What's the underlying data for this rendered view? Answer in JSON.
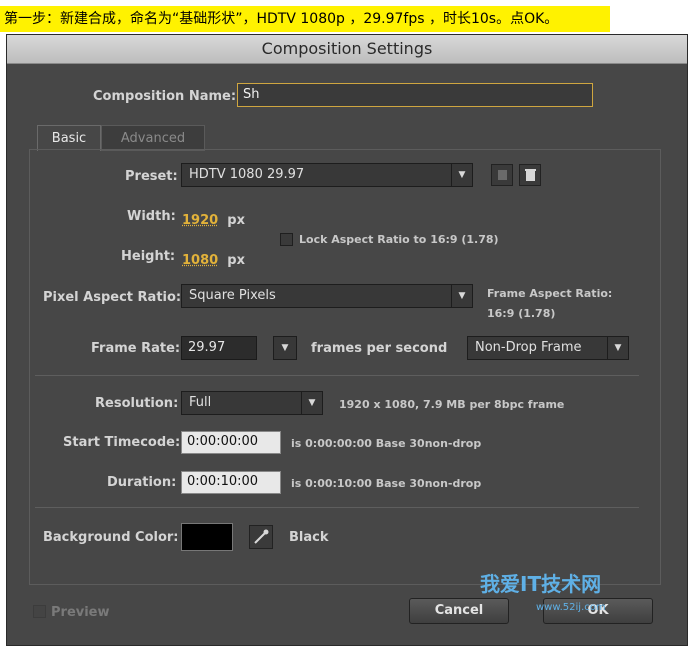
{
  "banner": {
    "text": "第一步：新建合成，命名为“基础形状”，HDTV 1080p ，29.97fps ，时长10s。点OK。"
  },
  "dialog": {
    "title": "Composition Settings",
    "comp_name_label": "Composition Name:",
    "comp_name_value": "Sh",
    "tabs": [
      "Basic",
      "Advanced"
    ],
    "preset_label": "Preset:",
    "preset_value": "HDTV 1080 29.97",
    "width_label": "Width:",
    "width_value": "1920",
    "height_label": "Height:",
    "height_value": "1080",
    "px_unit": "px",
    "lock_aspect_label": "Lock Aspect Ratio to 16:9 (1.78)",
    "pixel_aspect_label": "Pixel Aspect Ratio:",
    "pixel_aspect_value": "Square Pixels",
    "frame_aspect_label": "Frame Aspect Ratio:",
    "frame_aspect_value": "16:9 (1.78)",
    "frame_rate_label": "Frame Rate:",
    "frame_rate_value": "29.97",
    "frames_per_second": "frames per second",
    "drop_frame_value": "Non-Drop Frame",
    "resolution_label": "Resolution:",
    "resolution_value": "Full",
    "resolution_info": "1920 x 1080, 7.9 MB per 8bpc frame",
    "start_tc_label": "Start Timecode:",
    "start_tc_value": "0:00:00:00",
    "start_tc_info": "is 0:00:00:00  Base 30non-drop",
    "duration_label": "Duration:",
    "duration_value": "0:00:10:00",
    "duration_info": "is 0:00:10:00  Base 30non-drop",
    "bg_color_label": "Background Color:",
    "bg_color_name": "Black",
    "bg_color_hex": "#000000",
    "preview_label": "Preview",
    "cancel_label": "Cancel",
    "ok_label": "OK"
  },
  "watermark": {
    "text": "我爱IT技术网",
    "url_text": "www.52ij.com"
  },
  "icons": [
    "chevron-down-icon",
    "save-preset-icon",
    "trash-icon",
    "eyedropper-icon",
    "checkbox-icon"
  ]
}
